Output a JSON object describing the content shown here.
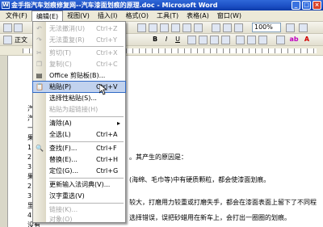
{
  "window": {
    "title": "金手指汽车划痕修复网--汽车漆面划痕的原理.doc - Microsoft Word"
  },
  "menubar": [
    "文件(F)",
    "编辑(E)",
    "视图(V)",
    "插入(I)",
    "格式(O)",
    "工具(T)",
    "表格(A)",
    "窗口(W)"
  ],
  "toolbar": {
    "style": "正文",
    "zoom": "100%"
  },
  "edit_menu": {
    "items": [
      {
        "label": "无法撤消(U)",
        "shortcut": "Ctrl+Z",
        "icon": "undo-icon",
        "glyph": "↶",
        "enabled": false
      },
      {
        "label": "无法重复(R)",
        "shortcut": "Ctrl+Y",
        "icon": "redo-icon",
        "glyph": "↷",
        "enabled": false
      },
      {
        "label": "剪切(T)",
        "shortcut": "Ctrl+X",
        "icon": "cut-icon",
        "glyph": "✂",
        "enabled": false
      },
      {
        "label": "复制(C)",
        "shortcut": "Ctrl+C",
        "icon": "copy-icon",
        "glyph": "❐",
        "enabled": false
      },
      {
        "label": "Office 剪贴板(B)...",
        "shortcut": "",
        "icon": "clipboard-icon",
        "glyph": "▤",
        "enabled": true
      },
      {
        "label": "粘贴(P)",
        "shortcut": "Ctrl+V",
        "icon": "paste-icon",
        "glyph": "📋",
        "enabled": true,
        "highlighted": true
      },
      {
        "label": "选择性粘贴(S)...",
        "shortcut": "",
        "icon": "",
        "glyph": "",
        "enabled": true
      },
      {
        "label": "粘贴为超链接(H)",
        "shortcut": "",
        "icon": "",
        "glyph": "",
        "enabled": false
      },
      {
        "label": "清除(A)",
        "shortcut": "",
        "icon": "",
        "glyph": "",
        "enabled": true,
        "submenu": true
      },
      {
        "label": "全选(L)",
        "shortcut": "Ctrl+A",
        "icon": "",
        "glyph": "",
        "enabled": true
      },
      {
        "label": "查找(F)...",
        "shortcut": "Ctrl+F",
        "icon": "find-icon",
        "glyph": "🔍",
        "enabled": true
      },
      {
        "label": "替换(E)...",
        "shortcut": "Ctrl+H",
        "icon": "",
        "glyph": "",
        "enabled": true
      },
      {
        "label": "定位(G)...",
        "shortcut": "Ctrl+G",
        "icon": "",
        "glyph": "",
        "enabled": true
      },
      {
        "label": "更新输入法词典(V)...",
        "shortcut": "",
        "icon": "",
        "glyph": "",
        "enabled": true
      },
      {
        "label": "汉字重选(V)",
        "shortcut": "",
        "icon": "",
        "glyph": "",
        "enabled": true
      },
      {
        "label": "链接(K)...",
        "shortcut": "",
        "icon": "",
        "glyph": "",
        "enabled": false
      },
      {
        "label": "对象(O)",
        "shortcut": "",
        "icon": "",
        "glyph": "",
        "enabled": false
      }
    ]
  },
  "document": {
    "lines": [
      "汽车",
      "汽车",
      "一、",
      "果在",
      "1.跟",
      "2.汽",
      "3.用",
      "果在",
      "2.漆",
      "3.清",
      "里，",
      "4.",
      "没有",
      "5.的"
    ],
    "line1_tail": "。其产生的原因是：",
    "line2_tail": "(海绵、毛巾等)中有硬质颗粒，都会使漆面划痕。",
    "line3_tail": "较大，打磨用力较重或打磨失手，都会在漆面表面上留下了不同程",
    "line4_tail": "选择错误，误把砂蜡用在新车上，会打出一圈圈的划痕。"
  }
}
